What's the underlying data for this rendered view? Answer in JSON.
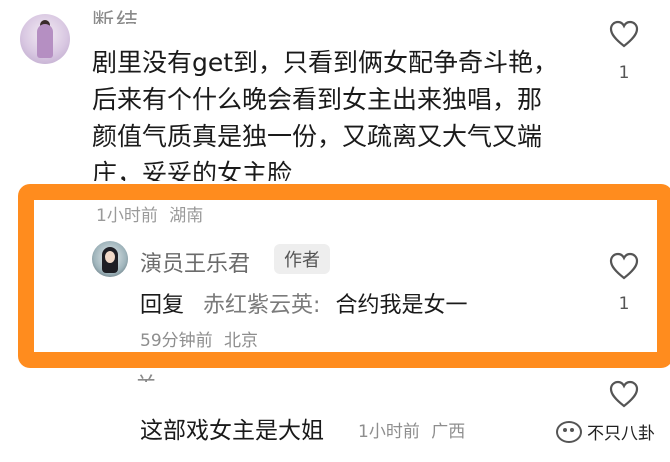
{
  "comment1": {
    "username_partial": "断结…",
    "text": "剧里没有get到，只看到俩女配争奇斗艳，后来有个什么晚会看到女主出来独唱，那颜值气质真是独一份，又疏离又大气又端庄，妥妥的女主脸",
    "time": "1小时前",
    "location": "湖南",
    "likes": "1"
  },
  "reply": {
    "username": "演员王乐君",
    "badge": "作者",
    "reply_prefix": "回复",
    "reply_to": "赤红紫云英",
    "separator": ":",
    "text": "合约我是女一",
    "time": "59分钟前",
    "location": "北京",
    "likes": "1"
  },
  "comment3": {
    "username_partial": "关…",
    "text": "这部戏女主是大姐",
    "time": "1小时前",
    "location": "广西"
  },
  "watermark": {
    "text": "不只八卦"
  },
  "colors": {
    "highlight": "#ff8c1e"
  },
  "icons": [
    "heart-icon",
    "avatar",
    "wechat-icon"
  ]
}
